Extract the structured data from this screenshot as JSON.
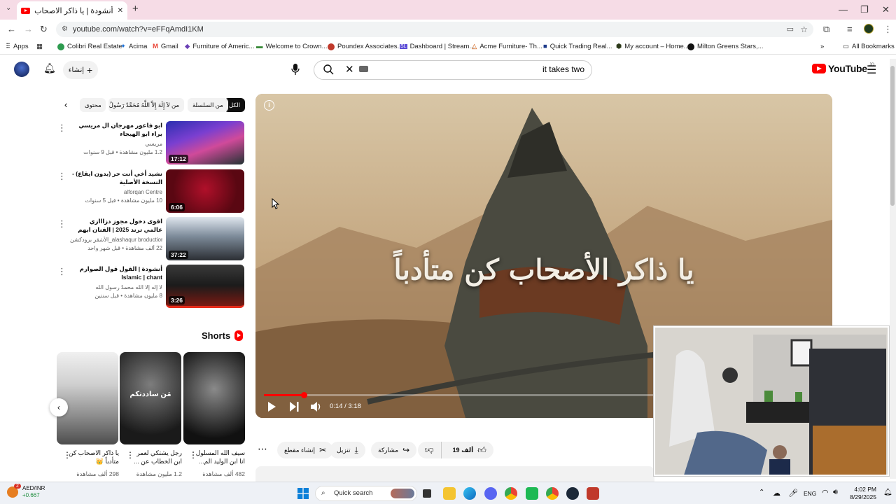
{
  "browser": {
    "tab_title": "أنشودة | يا ذاكر الاصحاب كن متأدباً",
    "new_tab_symbol": "+",
    "url": "youtube.com/watch?v=eFFqAmdI1KM",
    "window_controls": {
      "minimize": "—",
      "maximize": "❐",
      "close": "✕"
    },
    "bookmarks": [
      {
        "label": "Apps",
        "color": "#4285f4"
      },
      {
        "label": "Colibri Real Estate",
        "color": "#2e9b4f"
      },
      {
        "label": "Acima",
        "color": "#1b6fd6"
      },
      {
        "label": "Gmail",
        "color": "#ea4335"
      },
      {
        "label": "Furniture of Americ...",
        "color": "#6a3fb5"
      },
      {
        "label": "Welcome to Crown...",
        "color": "#3a8a3a"
      },
      {
        "label": "Poundex Associates...",
        "color": "#c0392b"
      },
      {
        "label": "Dashboard | Stream...",
        "color": "#5b4bd6"
      },
      {
        "label": "Acme Furniture- Th...",
        "color": "#d35400"
      },
      {
        "label": "Quick Trading Real...",
        "color": "#1e3a8a"
      },
      {
        "label": "My account – Home...",
        "color": "#2d3a1a"
      },
      {
        "label": "Milton Greens Stars,...",
        "color": "#111111"
      }
    ],
    "all_bookmarks": "All Bookmarks"
  },
  "youtube": {
    "create_label": "إنشاء",
    "search_value": "it takes two",
    "logo_text": "YouTube",
    "logo_region": "JO",
    "chips": [
      "الكل",
      "من السلسلة",
      "من لاَ إِلَهَ إِلاَّ اللَّهُ مُحَمَّدٌ رَسُولُ اللَّهِ",
      "محتوى"
    ],
    "related": [
      {
        "title": "ابو فاعور مهرجان ال مريسي براء ابو الهيجاء",
        "channel": "مريسي",
        "meta": "1.2 مليون مشاهدة • قبل 9 سنوات",
        "duration": "17:12"
      },
      {
        "title": "نشيد أخي أنت حر (بدون ايقاع) - النسخة الأصلية",
        "channel": "alforqan Centre",
        "meta": "10 مليون مشاهدة • قبل 5 سنوات",
        "duration": "6:06"
      },
      {
        "title": "اقوى دخول مجوز دزااازي عالمي ترند 2025 | الفنان ابهم البشتاوي | مهرجان ...",
        "channel": "الأشقر برودكشن_alashaqur broduction",
        "meta": "22 ألف مشاهدة • قبل شهر واحد",
        "duration": "37:22"
      },
      {
        "title": "أنشودة | القول قول الصوارم Islamic | chant",
        "channel": "لا إله إلا الله محمدٌ رسول الله",
        "meta": "8 مليون مشاهدة • قبل سنتين",
        "duration": "3:26"
      }
    ],
    "shorts_heading": "Shorts",
    "shorts": [
      {
        "title": "يا ذاكر الاصحاب كن متأدباً 👑",
        "views": "298 ألف مشاهدة"
      },
      {
        "title": "رجل يشتكي لعمر ابن الخطاب عن ...",
        "views": "1.2 مليون مشاهدة",
        "overlay": "مَن ساددتكم"
      },
      {
        "title": "سيف الله المسلول : انا ابن الوليد الم...",
        "views": "482 ألف مشاهدة"
      }
    ],
    "player": {
      "overlay_text": "يا ذاكر الأصحاب كن متأدباً",
      "time": "0:14 / 3:18",
      "progress": 0.0707
    },
    "actions": {
      "likes": "19 ألف",
      "share": "مشاركة",
      "download": "تنزيل",
      "clip": "إنشاء مقطع",
      "more": "⋯"
    }
  },
  "taskbar": {
    "stock_name": "AED/INR",
    "stock_change": "+0.667",
    "stock_badge": "2",
    "search_placeholder": "Quick search",
    "lang": "ENG",
    "time": "4:02 PM",
    "date": "8/29/2025"
  },
  "colors": {
    "yt_red": "#ff0000",
    "tab_strip": "#f6dce6",
    "progress": "#ff0000"
  }
}
